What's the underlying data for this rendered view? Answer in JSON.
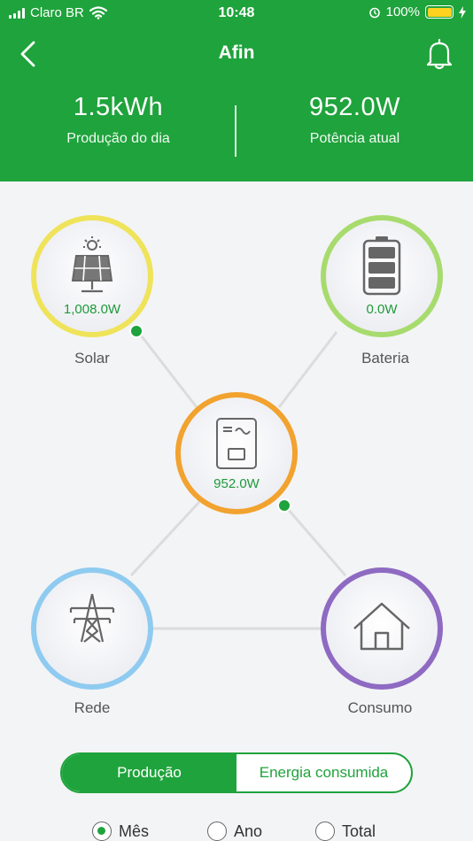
{
  "status_bar": {
    "carrier": "Claro BR",
    "time": "10:48",
    "battery": "100%"
  },
  "nav": {
    "title": "Afin"
  },
  "stats": {
    "daily": {
      "value": "1.5kWh",
      "label": "Produção do dia"
    },
    "current": {
      "value": "952.0W",
      "label": "Potência atual"
    }
  },
  "nodes": {
    "solar": {
      "label": "Solar",
      "value": "1,008.0W",
      "ring": "#f0e04a"
    },
    "battery": {
      "label": "Bateria",
      "value": "0.0W",
      "ring": "#a3d96a"
    },
    "inverter": {
      "value": "952.0W",
      "ring": "#f0a02a"
    },
    "grid": {
      "label": "Rede",
      "ring": "#8ccaf0"
    },
    "home": {
      "label": "Consumo",
      "ring": "#8e6ac0"
    }
  },
  "toggle": {
    "production": "Produção",
    "consumed": "Energia consumida"
  },
  "period": {
    "month": "Mês",
    "year": "Ano",
    "total": "Total",
    "selected": "month"
  },
  "colors": {
    "brand": "#1fa33c",
    "flow_dot": "#1fa33c",
    "line": "#d9d9d9"
  }
}
